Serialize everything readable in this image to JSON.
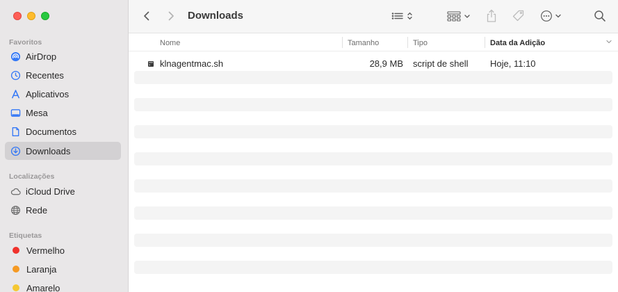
{
  "window": {
    "title": "Downloads"
  },
  "sidebar": {
    "sections": [
      {
        "label": "Favoritos",
        "items": [
          {
            "label": "AirDrop",
            "icon": "airdrop-icon"
          },
          {
            "label": "Recentes",
            "icon": "clock-icon"
          },
          {
            "label": "Aplicativos",
            "icon": "applications-icon"
          },
          {
            "label": "Mesa",
            "icon": "desktop-icon"
          },
          {
            "label": "Documentos",
            "icon": "document-icon"
          },
          {
            "label": "Downloads",
            "icon": "download-icon",
            "selected": true
          }
        ]
      },
      {
        "label": "Localizações",
        "items": [
          {
            "label": "iCloud Drive",
            "icon": "cloud-icon"
          },
          {
            "label": "Rede",
            "icon": "network-icon"
          }
        ]
      },
      {
        "label": "Etiquetas",
        "items": [
          {
            "label": "Vermelho",
            "color": "#f0322c"
          },
          {
            "label": "Laranja",
            "color": "#f59a23"
          },
          {
            "label": "Amarelo",
            "color": "#f5c833"
          }
        ]
      }
    ]
  },
  "toolbar": {
    "back_icon": "chevron-left-icon",
    "forward_icon": "chevron-right-icon",
    "view_icon": "list-view-icon",
    "group_icon": "group-grid-icon",
    "share_icon": "share-icon",
    "tag_icon": "tag-icon",
    "more_icon": "ellipsis-circle-icon",
    "search_icon": "search-icon"
  },
  "columns": {
    "name": "Nome",
    "size": "Tamanho",
    "kind": "Tipo",
    "date": "Data da Adição"
  },
  "files": [
    {
      "name": "klnagentmac.sh",
      "size": "28,9 MB",
      "kind": "script de shell",
      "date": "Hoje, 11:10",
      "icon": "shell-script-icon"
    }
  ],
  "colors": {
    "sidebar_accent": "#3478f6",
    "selected_item_bg": "#d3d1d3"
  }
}
